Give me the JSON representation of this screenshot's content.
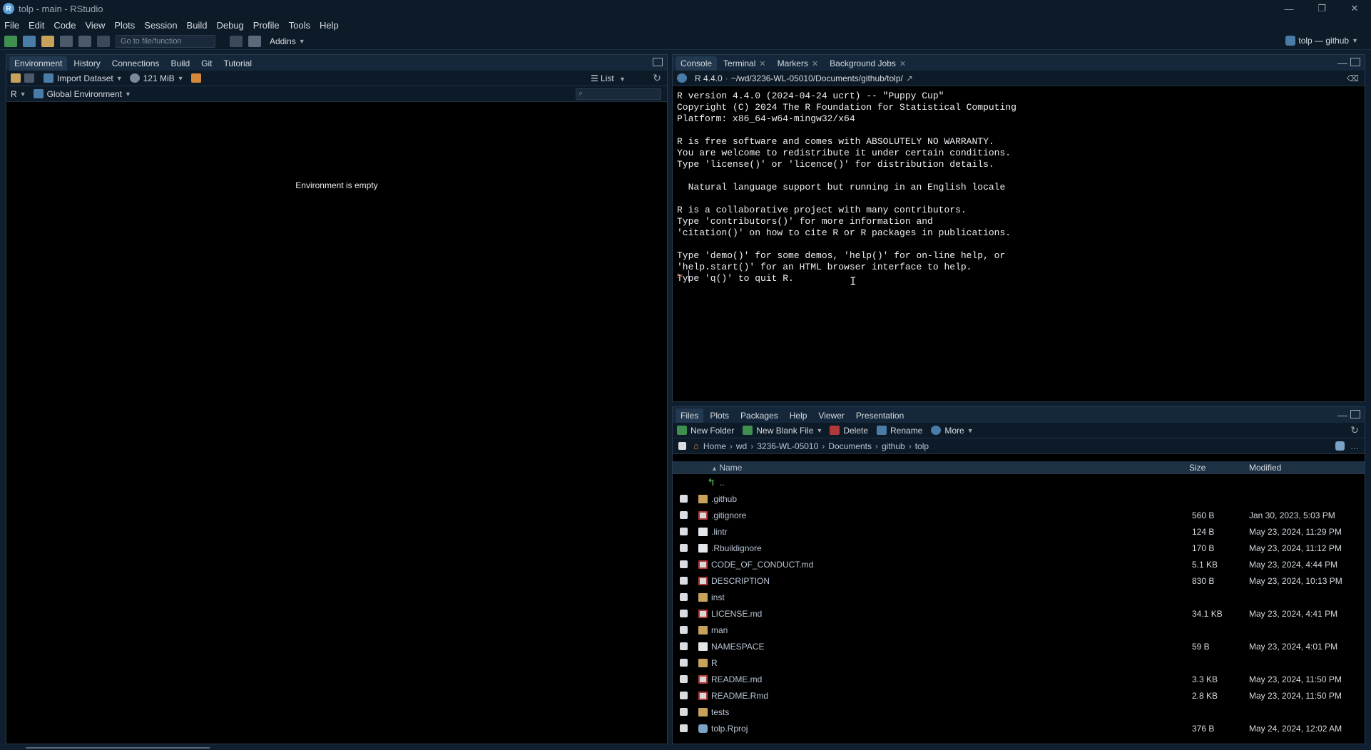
{
  "window": {
    "title": "tolp - main - RStudio",
    "logo_letter": "R",
    "controls": [
      "—",
      "❐",
      "✕"
    ]
  },
  "menu": [
    "File",
    "Edit",
    "Code",
    "View",
    "Plots",
    "Session",
    "Build",
    "Debug",
    "Profile",
    "Tools",
    "Help"
  ],
  "toolbar": {
    "goto_placeholder": "Go to file/function",
    "addins_label": "Addins",
    "project_label": "tolp — github"
  },
  "left_pane": {
    "tabs": [
      "Environment",
      "History",
      "Connections",
      "Build",
      "Git",
      "Tutorial"
    ],
    "active_tab": "Environment",
    "import_dataset": "Import Dataset",
    "memory": "121 MiB",
    "view_mode": "List",
    "language": "R",
    "scope": "Global Environment",
    "empty_message": "Environment is empty"
  },
  "console_pane": {
    "tabs": [
      {
        "label": "Console",
        "closable": false
      },
      {
        "label": "Terminal",
        "closable": true
      },
      {
        "label": "Markers",
        "closable": true
      },
      {
        "label": "Background Jobs",
        "closable": true
      }
    ],
    "r_version": "R 4.4.0",
    "path": "~/wd/3236-WL-05010/Documents/github/tolp/",
    "output": "R version 4.4.0 (2024-04-24 ucrt) -- \"Puppy Cup\"\nCopyright (C) 2024 The R Foundation for Statistical Computing\nPlatform: x86_64-w64-mingw32/x64\n\nR is free software and comes with ABSOLUTELY NO WARRANTY.\nYou are welcome to redistribute it under certain conditions.\nType 'license()' or 'licence()' for distribution details.\n\n  Natural language support but running in an English locale\n\nR is a collaborative project with many contributors.\nType 'contributors()' for more information and\n'citation()' on how to cite R or R packages in publications.\n\nType 'demo()' for some demos, 'help()' for on-line help, or\n'help.start()' for an HTML browser interface to help.\nType 'q()' to quit R.",
    "prompt": ">"
  },
  "files_pane": {
    "tabs": [
      "Files",
      "Plots",
      "Packages",
      "Help",
      "Viewer",
      "Presentation"
    ],
    "active_tab": "Files",
    "actions": {
      "new_folder": "New Folder",
      "new_blank_file": "New Blank File",
      "delete": "Delete",
      "rename": "Rename",
      "more": "More"
    },
    "breadcrumb": [
      "Home",
      "wd",
      "3236-WL-05010",
      "Documents",
      "github",
      "tolp"
    ],
    "columns": {
      "name": "Name",
      "size": "Size",
      "modified": "Modified"
    },
    "parent_label": "..",
    "files": [
      {
        "name": ".github",
        "kind": "folder",
        "size": "",
        "modified": ""
      },
      {
        "name": ".gitignore",
        "kind": "rfile",
        "size": "560 B",
        "modified": "Jan 30, 2023, 5:03 PM"
      },
      {
        "name": ".lintr",
        "kind": "file",
        "size": "124 B",
        "modified": "May 23, 2024, 11:29 PM"
      },
      {
        "name": ".Rbuildignore",
        "kind": "file",
        "size": "170 B",
        "modified": "May 23, 2024, 11:12 PM"
      },
      {
        "name": "CODE_OF_CONDUCT.md",
        "kind": "rfile",
        "size": "5.1 KB",
        "modified": "May 23, 2024, 4:44 PM"
      },
      {
        "name": "DESCRIPTION",
        "kind": "rfile",
        "size": "830 B",
        "modified": "May 23, 2024, 10:13 PM"
      },
      {
        "name": "inst",
        "kind": "folder",
        "size": "",
        "modified": ""
      },
      {
        "name": "LICENSE.md",
        "kind": "rfile",
        "size": "34.1 KB",
        "modified": "May 23, 2024, 4:41 PM"
      },
      {
        "name": "man",
        "kind": "folder",
        "size": "",
        "modified": ""
      },
      {
        "name": "NAMESPACE",
        "kind": "file",
        "size": "59 B",
        "modified": "May 23, 2024, 4:01 PM"
      },
      {
        "name": "R",
        "kind": "folder",
        "size": "",
        "modified": ""
      },
      {
        "name": "README.md",
        "kind": "rfile",
        "size": "3.3 KB",
        "modified": "May 23, 2024, 11:50 PM"
      },
      {
        "name": "README.Rmd",
        "kind": "rfile",
        "size": "2.8 KB",
        "modified": "May 23, 2024, 11:50 PM"
      },
      {
        "name": "tests",
        "kind": "folder",
        "size": "",
        "modified": ""
      },
      {
        "name": "tolp.Rproj",
        "kind": "rproj",
        "size": "376 B",
        "modified": "May 24, 2024, 12:02 AM"
      }
    ]
  }
}
